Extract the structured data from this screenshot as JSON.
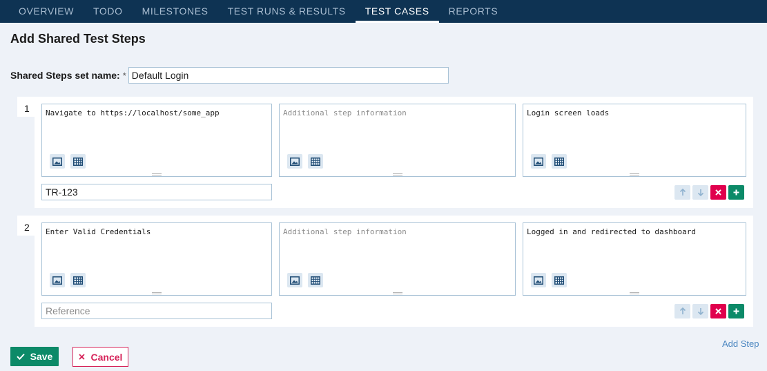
{
  "nav": {
    "tabs": [
      {
        "label": "OVERVIEW"
      },
      {
        "label": "TODO"
      },
      {
        "label": "MILESTONES"
      },
      {
        "label": "TEST RUNS & RESULTS"
      },
      {
        "label": "TEST CASES",
        "active": true
      },
      {
        "label": "REPORTS"
      }
    ]
  },
  "page": {
    "title": "Add Shared Test Steps",
    "name_label": "Shared Steps set name:",
    "required_mark": "*",
    "name_value": "Default Login"
  },
  "steps": [
    {
      "number": "1",
      "content": "Navigate to https://localhost/some_app",
      "additional_placeholder": "Additional step information",
      "expected": "Login screen loads",
      "reference_value": "TR-123",
      "reference_placeholder": "Reference"
    },
    {
      "number": "2",
      "content": "Enter Valid Credentials",
      "additional_placeholder": "Additional step information",
      "expected": "Logged in and redirected to dashboard",
      "reference_value": "",
      "reference_placeholder": "Reference"
    }
  ],
  "actions": {
    "add_step": "Add Step",
    "save": "Save",
    "cancel": "Cancel"
  },
  "icons": {
    "image": "image-icon",
    "table": "table-icon",
    "move_up": "arrow-up-icon",
    "move_down": "arrow-down-icon",
    "delete": "close-icon",
    "add": "plus-icon",
    "save": "check-icon",
    "cancel": "x-icon"
  },
  "colors": {
    "nav_bg": "#0e3353",
    "page_bg": "#eef2f8",
    "save_green": "#0c8a68",
    "delete_red": "#e0004d",
    "link_blue": "#4a86c0"
  }
}
